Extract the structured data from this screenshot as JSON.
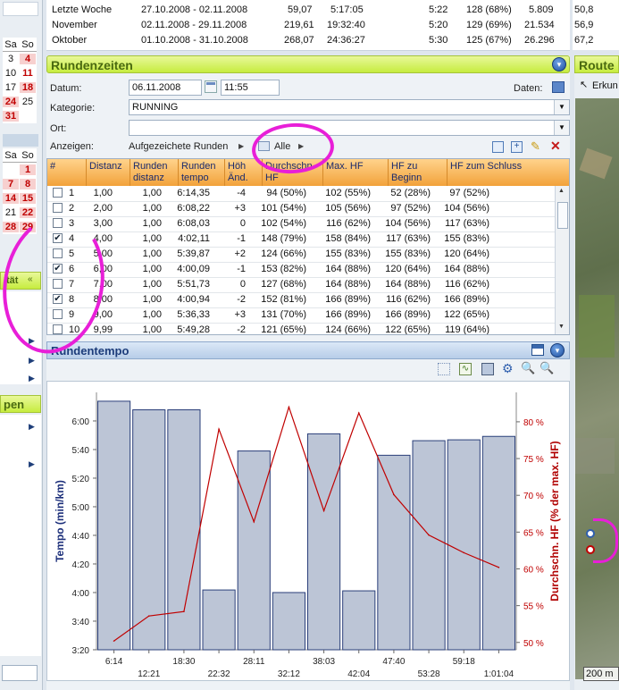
{
  "summary": {
    "rows": [
      {
        "label": "Letzte Woche",
        "range": "27.10.2008 - 02.11.2008",
        "distance": "59,07",
        "time": "5:17:05",
        "pace": "5:22",
        "hf": "128 (68%)",
        "kcal": "5.809",
        "right": "50,8"
      },
      {
        "label": "November",
        "range": "02.11.2008 - 29.11.2008",
        "distance": "219,61",
        "time": "19:32:40",
        "pace": "5:20",
        "hf": "129 (69%)",
        "kcal": "21.534",
        "right": "56,9"
      },
      {
        "label": "Oktober",
        "range": "01.10.2008 - 31.10.2008",
        "distance": "268,07",
        "time": "24:36:27",
        "pace": "5:30",
        "hf": "125 (67%)",
        "kcal": "26.296",
        "right": "67,2"
      }
    ]
  },
  "left": {
    "cal1_head": [
      "Sa",
      "So"
    ],
    "cal1_rows": [
      [
        "3",
        "4"
      ],
      [
        "10",
        "11"
      ],
      [
        "17",
        "18"
      ],
      [
        "24",
        "25"
      ],
      [
        "31",
        ""
      ]
    ],
    "cal2_head": [
      "Sa",
      "So"
    ],
    "cal2_rows": [
      [
        "",
        "1"
      ],
      [
        "7",
        "8"
      ],
      [
        "14",
        "15"
      ],
      [
        "21",
        "22"
      ],
      [
        "28",
        "29"
      ]
    ],
    "section1_label": "tät",
    "section2_label": "pen"
  },
  "runden": {
    "title": "Rundenzeiten",
    "datum_label": "Datum:",
    "datum_value": "06.11.2008",
    "time_value": "11:55",
    "daten_label": "Daten:",
    "kategorie_label": "Kategorie:",
    "kategorie_value": "RUNNING",
    "ort_label": "Ort:",
    "anzeigen_label": "Anzeigen:",
    "anzeigen_value": "Aufgezeichete Runden",
    "filter_value": "Alle"
  },
  "grid": {
    "headers": [
      "#",
      "Distanz",
      "Runden distanz",
      "Runden tempo",
      "Höh Änd.",
      "Durchschn. HF",
      "Max. HF",
      "HF zu Beginn",
      "HF zum Schluss"
    ],
    "rows": [
      {
        "checked": false,
        "n": "1",
        "d": "1,00",
        "rd": "1,00",
        "t": "6:14,35",
        "h": "-4",
        "hf": "94 (50%)",
        "max": "102 (55%)",
        "beg": "52 (28%)",
        "end": "97 (52%)"
      },
      {
        "checked": false,
        "n": "2",
        "d": "2,00",
        "rd": "1,00",
        "t": "6:08,22",
        "h": "+3",
        "hf": "101 (54%)",
        "max": "105 (56%)",
        "beg": "97 (52%)",
        "end": "104 (56%)"
      },
      {
        "checked": false,
        "n": "3",
        "d": "3,00",
        "rd": "1,00",
        "t": "6:08,03",
        "h": "0",
        "hf": "102 (54%)",
        "max": "116 (62%)",
        "beg": "104 (56%)",
        "end": "117 (63%)"
      },
      {
        "checked": true,
        "n": "4",
        "d": "4,00",
        "rd": "1,00",
        "t": "4:02,11",
        "h": "-1",
        "hf": "148 (79%)",
        "max": "158 (84%)",
        "beg": "117 (63%)",
        "end": "155 (83%)"
      },
      {
        "checked": false,
        "n": "5",
        "d": "5,00",
        "rd": "1,00",
        "t": "5:39,87",
        "h": "+2",
        "hf": "124 (66%)",
        "max": "155 (83%)",
        "beg": "155 (83%)",
        "end": "120 (64%)"
      },
      {
        "checked": true,
        "n": "6",
        "d": "6,00",
        "rd": "1,00",
        "t": "4:00,09",
        "h": "-1",
        "hf": "153 (82%)",
        "max": "164 (88%)",
        "beg": "120 (64%)",
        "end": "164 (88%)"
      },
      {
        "checked": false,
        "n": "7",
        "d": "7,00",
        "rd": "1,00",
        "t": "5:51,73",
        "h": "0",
        "hf": "127 (68%)",
        "max": "164 (88%)",
        "beg": "164 (88%)",
        "end": "116 (62%)"
      },
      {
        "checked": true,
        "n": "8",
        "d": "8,00",
        "rd": "1,00",
        "t": "4:00,94",
        "h": "-2",
        "hf": "152 (81%)",
        "max": "166 (89%)",
        "beg": "116 (62%)",
        "end": "166 (89%)"
      },
      {
        "checked": false,
        "n": "9",
        "d": "9,00",
        "rd": "1,00",
        "t": "5:36,33",
        "h": "+3",
        "hf": "131 (70%)",
        "max": "166 (89%)",
        "beg": "166 (89%)",
        "end": "122 (65%)"
      },
      {
        "checked": false,
        "n": "10",
        "d": "9,99",
        "rd": "1,00",
        "t": "5:49,28",
        "h": "-2",
        "hf": "121 (65%)",
        "max": "124 (66%)",
        "beg": "122 (65%)",
        "end": "119 (64%)"
      }
    ]
  },
  "chart_panel": {
    "title": "Rundentempo"
  },
  "right": {
    "title": "Route",
    "tool_label": "Erkun",
    "scale_label": "200 m"
  },
  "colors": {
    "accent": "#c6ec3f",
    "bar_fill": "#bcc5d6",
    "hr_line": "#c00000",
    "annotation": "#e81fd8"
  },
  "chart_data": {
    "type": "bar",
    "categories": [
      "6:14",
      "12:21",
      "18:30",
      "22:32",
      "28:11",
      "32:12",
      "38:03",
      "42:04",
      "47:40",
      "53:28",
      "59:18",
      "1:01:04"
    ],
    "x_tick_labels_upper": [
      "6:14",
      "18:30",
      "28:11",
      "38:03",
      "47:40",
      "59:18"
    ],
    "x_tick_labels_lower": [
      "12:21",
      "22:32",
      "32:12",
      "42:04",
      "53:28",
      "1:01:04"
    ],
    "series": [
      {
        "name": "",
        "axis": "left",
        "type": "bar",
        "values": [
          6.23,
          6.13,
          6.13,
          4.03,
          5.65,
          4.0,
          5.85,
          4.02,
          5.6,
          5.77,
          5.78,
          5.82
        ],
        "value_unit": "minutes per km"
      },
      {
        "name": "",
        "axis": "right",
        "type": "line",
        "values": [
          50.2,
          53.6,
          54.2,
          79.0,
          66.4,
          82.0,
          67.9,
          81.2,
          70.1,
          64.6,
          62.2,
          60.2
        ]
      }
    ],
    "ylabel": "Tempo (min/km)",
    "ylabel_right": "Durchschn. HF (% der max. HF)",
    "y_ticks": [
      "6:00",
      "5:40",
      "5:20",
      "5:00",
      "4:40",
      "4:20",
      "4:00",
      "3:40",
      "3:20"
    ],
    "y_ticks_right": [
      "80 %",
      "75 %",
      "70 %",
      "65 %",
      "60 %",
      "55 %",
      "50 %"
    ],
    "ylim": [
      3.333,
      6.333
    ],
    "ylim_right": [
      49,
      84
    ],
    "grid": false,
    "legend": "none"
  }
}
